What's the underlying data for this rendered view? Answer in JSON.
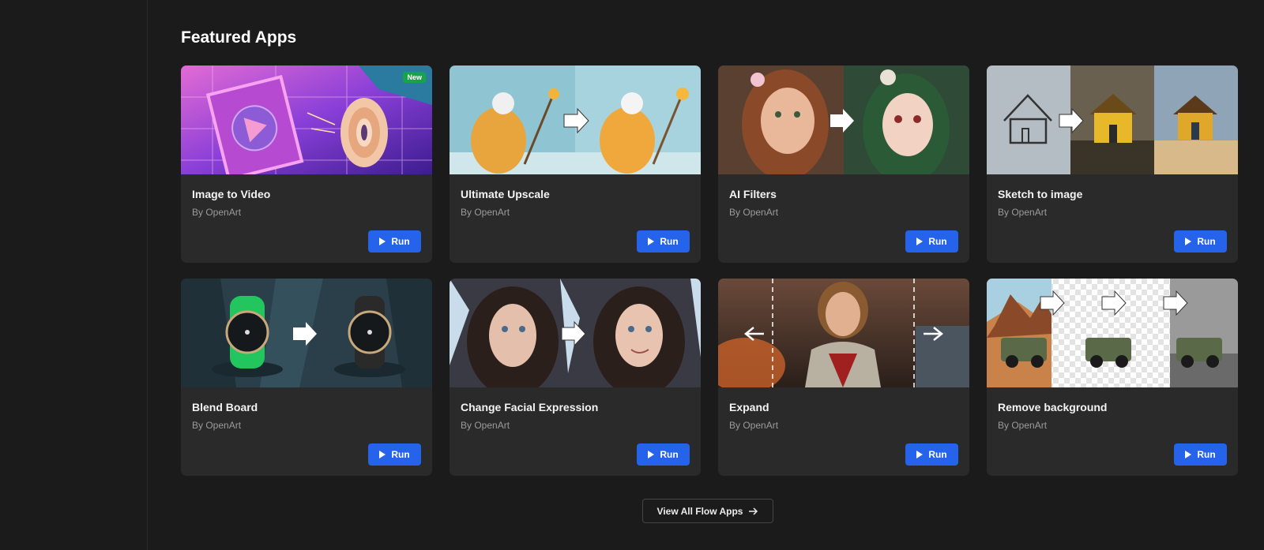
{
  "section": {
    "title": "Featured Apps"
  },
  "apps": [
    {
      "title": "Image to Video",
      "author": "By OpenArt",
      "run_label": "Run",
      "badge": "New"
    },
    {
      "title": "Ultimate Upscale",
      "author": "By OpenArt",
      "run_label": "Run"
    },
    {
      "title": "AI Filters",
      "author": "By OpenArt",
      "run_label": "Run"
    },
    {
      "title": "Sketch to image",
      "author": "By OpenArt",
      "run_label": "Run"
    },
    {
      "title": "Blend Board",
      "author": "By OpenArt",
      "run_label": "Run"
    },
    {
      "title": "Change Facial Expression",
      "author": "By OpenArt",
      "run_label": "Run"
    },
    {
      "title": "Expand",
      "author": "By OpenArt",
      "run_label": "Run"
    },
    {
      "title": "Remove background",
      "author": "By OpenArt",
      "run_label": "Run"
    }
  ],
  "footer": {
    "view_all_label": "View All Flow Apps",
    "view_all_icon": "arrow-right-icon"
  },
  "colors": {
    "background": "#1b1b1b",
    "card": "#2a2a2a",
    "accent": "#2563eb",
    "new_badge": "#16a34a"
  }
}
